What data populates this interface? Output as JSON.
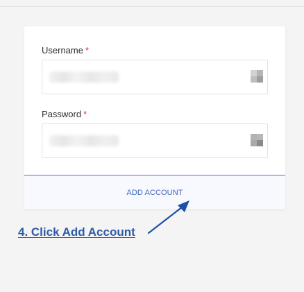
{
  "form": {
    "username": {
      "label": "Username",
      "required_mark": "*",
      "icon": "key-icon"
    },
    "password": {
      "label": "Password",
      "required_mark": "*",
      "icon": "key-icon"
    },
    "submit_label": "ADD ACCOUNT"
  },
  "annotation": {
    "text": "4. Click Add Account",
    "color": "#2e5aa6"
  },
  "colors": {
    "accent": "#3a66c0",
    "required": "#d9383a"
  }
}
